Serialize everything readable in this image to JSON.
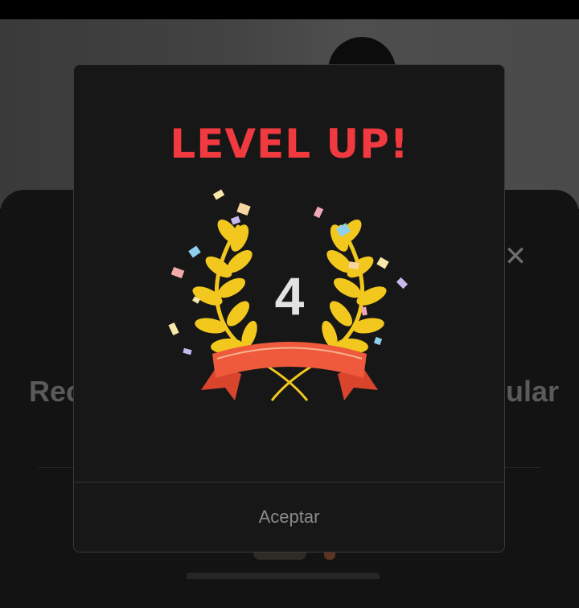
{
  "background": {
    "text_left": "Rec",
    "text_right": "ular",
    "close_icon": "close-icon"
  },
  "dialog": {
    "title": "LEVEL UP!",
    "level": "4",
    "accept_label": "Aceptar",
    "badge_icon": "laurel-wreath-icon"
  },
  "colors": {
    "title": "#f03a3f",
    "laurel": "#f2c81f",
    "ribbon": "#ef5a3c",
    "dialog_bg": "#171717"
  }
}
